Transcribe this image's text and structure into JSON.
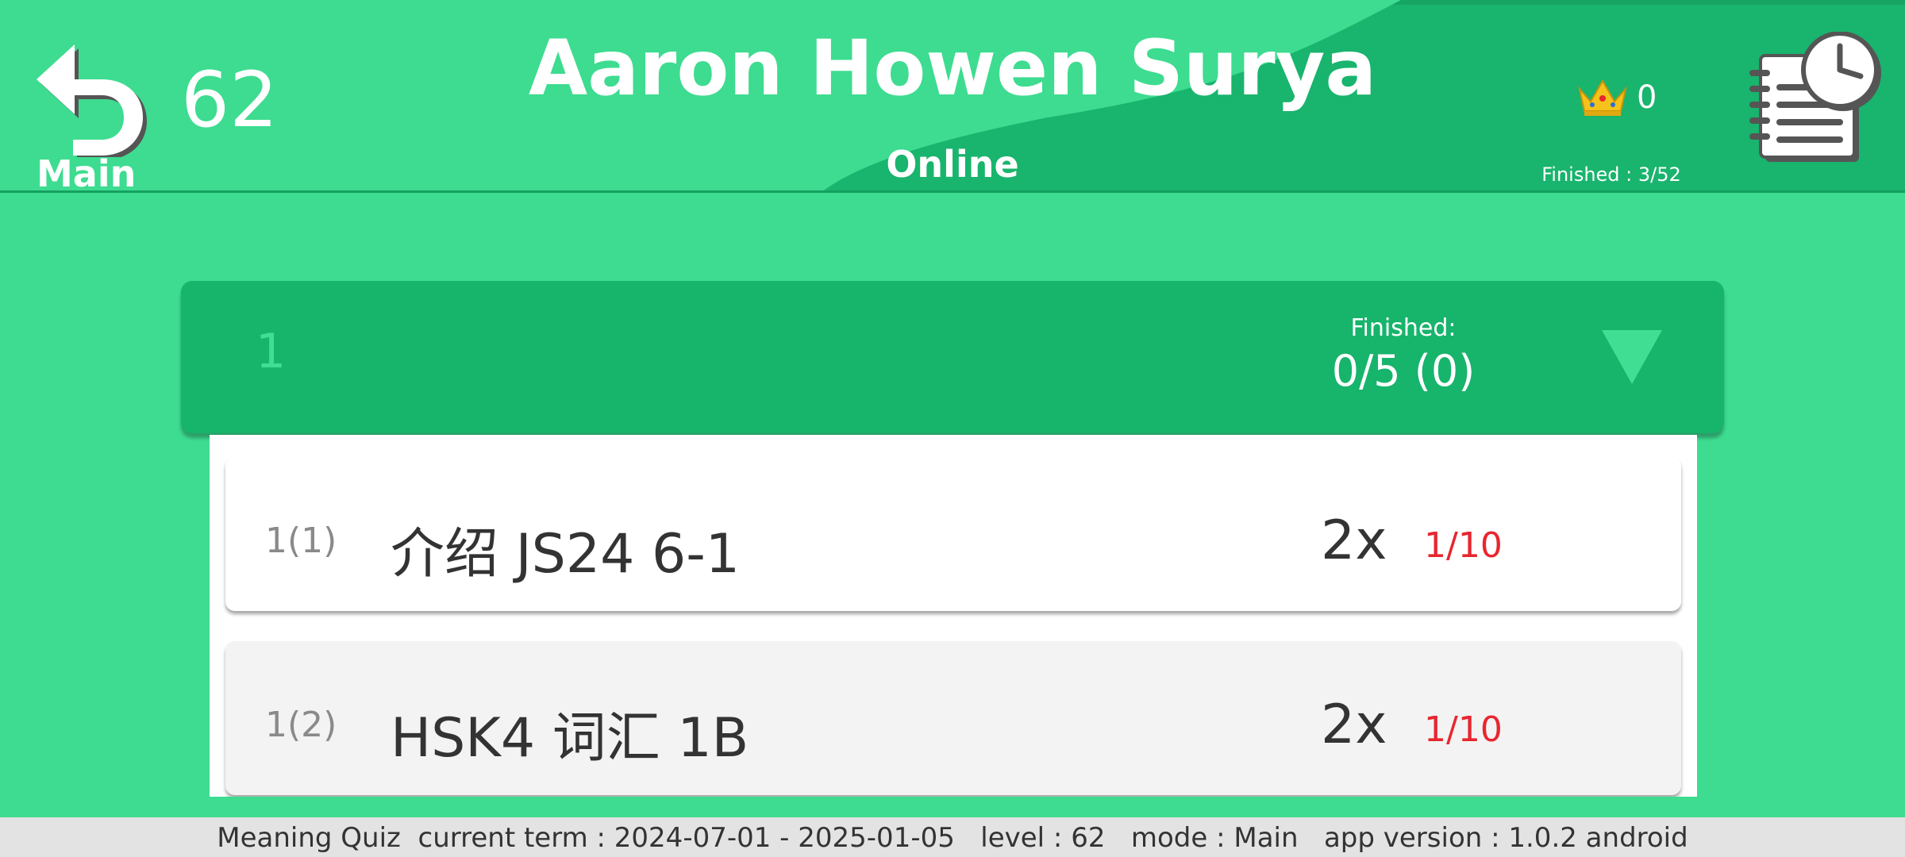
{
  "header": {
    "back_label": "Main",
    "level_number": "62",
    "user_name": "Aaron Howen Surya",
    "status": "Online",
    "crown_count": "0",
    "finished_total": "Finished : 3/52"
  },
  "group": {
    "number": "1",
    "finished_label": "Finished:",
    "finished_value": "0/5 (0)"
  },
  "items": [
    {
      "index": "1(1)",
      "title": "介绍 JS24 6-1",
      "multiplier": "2x",
      "score": "1/10"
    },
    {
      "index": "1(2)",
      "title": "HSK4 词汇 1B",
      "multiplier": "2x",
      "score": "1/10"
    }
  ],
  "footer": {
    "text": "Meaning Quiz  current term : 2024-07-01 - 2025-01-05   level : 62   mode : Main   app version : 1.0.2 android"
  },
  "icons": {
    "back": "back-arrow-icon",
    "crown": "crown-icon",
    "schedule": "schedule-notepad-clock-icon",
    "dropdown": "dropdown-triangle-icon"
  },
  "colors": {
    "background": "#3ddc90",
    "header": "#19b46d",
    "group_header": "#17b46c",
    "score_red": "#e8262f"
  }
}
